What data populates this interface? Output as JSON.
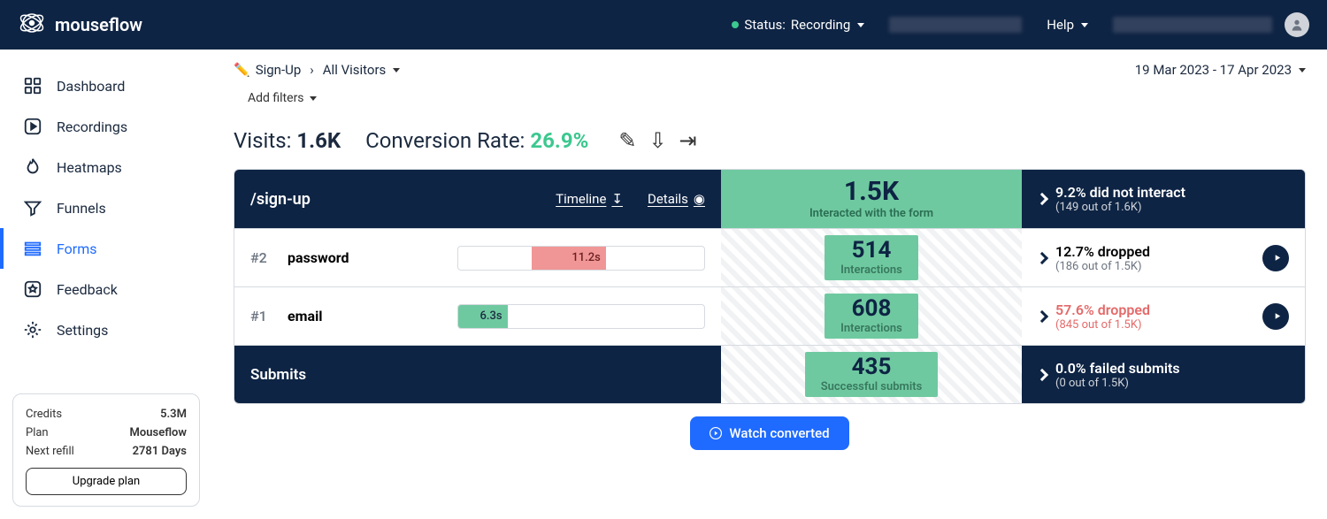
{
  "header": {
    "brand": "mouseflow",
    "status_prefix": "Status:",
    "status_value": "Recording",
    "help": "Help"
  },
  "sidebar": {
    "items": [
      {
        "label": "Dashboard"
      },
      {
        "label": "Recordings"
      },
      {
        "label": "Heatmaps"
      },
      {
        "label": "Funnels"
      },
      {
        "label": "Forms"
      },
      {
        "label": "Feedback"
      },
      {
        "label": "Settings"
      }
    ]
  },
  "plan": {
    "credits_label": "Credits",
    "credits_value": "5.3M",
    "plan_label": "Plan",
    "plan_value": "Mouseflow",
    "refill_label": "Next refill",
    "refill_value": "2781 Days",
    "upgrade": "Upgrade plan"
  },
  "breadcrumb": {
    "form_name": "Sign-Up",
    "segment": "All Visitors",
    "date_range": "19 Mar 2023 - 17 Apr 2023",
    "add_filters": "Add filters"
  },
  "metrics": {
    "visits_label": "Visits:",
    "visits_value": "1.6K",
    "conv_label": "Conversion Rate:",
    "conv_value": "26.9%"
  },
  "form": {
    "path": "/sign-up",
    "timeline_label": "Timeline",
    "details_label": "Details",
    "header_metric": {
      "value": "1.5K",
      "label": "Interacted with the form"
    },
    "header_drop": {
      "line": "9.2% did not interact",
      "sub": "(149 out of 1.6K)"
    },
    "fields": [
      {
        "rank": "#1",
        "name": "email",
        "time": "6.3s",
        "fill_pct": 20,
        "fill_color": "green",
        "interactions": {
          "value": "608",
          "label": "Interactions"
        },
        "drop": {
          "line": "57.6% dropped",
          "sub": "(845 out of 1.5K)",
          "red": true
        }
      },
      {
        "rank": "#2",
        "name": "password",
        "time": "11.2s",
        "fill_pct": 30,
        "fill_color": "red",
        "interactions": {
          "value": "514",
          "label": "Interactions"
        },
        "drop": {
          "line": "12.7% dropped",
          "sub": "(186 out of 1.5K)",
          "red": false
        }
      }
    ],
    "footer": {
      "label": "Submits",
      "metric": {
        "value": "435",
        "label": "Successful submits"
      },
      "drop": {
        "line": "0.0% failed submits",
        "sub": "(0 out of 1.5K)"
      }
    }
  },
  "watch_btn": "Watch converted"
}
